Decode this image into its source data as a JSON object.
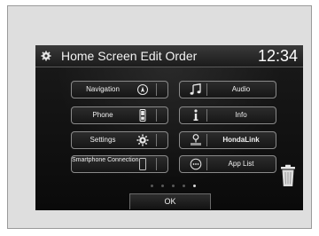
{
  "header": {
    "title": "Home Screen Edit Order",
    "clock": "12:34"
  },
  "tiles": [
    {
      "label": "Navigation",
      "icon": "navigation-compass-icon"
    },
    {
      "label": "Audio",
      "icon": "music-note-icon"
    },
    {
      "label": "Phone",
      "icon": "phone-icon"
    },
    {
      "label": "Info",
      "icon": "info-icon"
    },
    {
      "label": "Settings",
      "icon": "settings-gear-icon"
    },
    {
      "label": "HondaLink",
      "icon": "hondalink-icon"
    },
    {
      "label": "Smartphone Connection",
      "icon": "smartphone-icon"
    },
    {
      "label": "App List",
      "icon": "app-list-icon"
    }
  ],
  "pager": {
    "pages": 5,
    "active_index": 4
  },
  "footer": {
    "ok_label": "OK"
  },
  "icons": {
    "trash": "trash-icon"
  },
  "colors": {
    "screen_bg": "#0e0e0e",
    "tile_border": "#8a8a8a",
    "text": "#f0f0f0",
    "frame_bg": "#dedede"
  }
}
